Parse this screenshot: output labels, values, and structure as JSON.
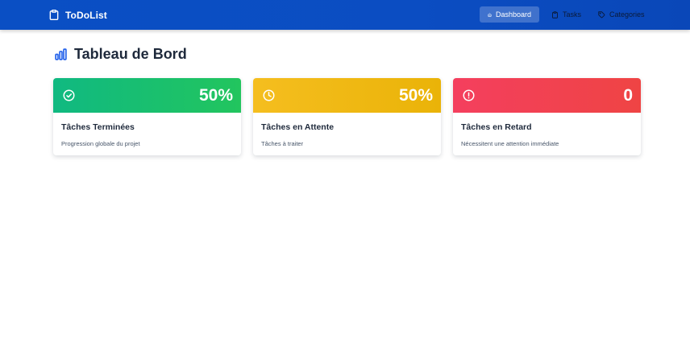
{
  "navbar": {
    "brand": "ToDoList",
    "brand_icon": "clipboard-icon",
    "items": [
      {
        "label": "Dashboard",
        "icon": "home-icon",
        "active": true
      },
      {
        "label": "Tasks",
        "icon": "clipboard-icon",
        "active": false
      },
      {
        "label": "Categories",
        "icon": "tag-icon",
        "active": false
      }
    ]
  },
  "page": {
    "title": "Tableau de Bord",
    "title_icon": "bar-chart-icon"
  },
  "cards": [
    {
      "value": "50%",
      "title": "Tâches Terminées",
      "subtitle": "Progression globale du projet",
      "icon": "check-circle-icon",
      "color": "#10b981"
    },
    {
      "value": "50%",
      "title": "Tâches en Attente",
      "subtitle": "Tâches à traiter",
      "icon": "clock-icon",
      "color": "#f5be1f"
    },
    {
      "value": "0",
      "title": "Tâches en Retard",
      "subtitle": "Nécessitent une attention immédiate",
      "icon": "alert-circle-icon",
      "color": "#f43f5e"
    }
  ],
  "colors": {
    "navbar": "#0a4fc4",
    "title_icon": "#2563eb"
  }
}
